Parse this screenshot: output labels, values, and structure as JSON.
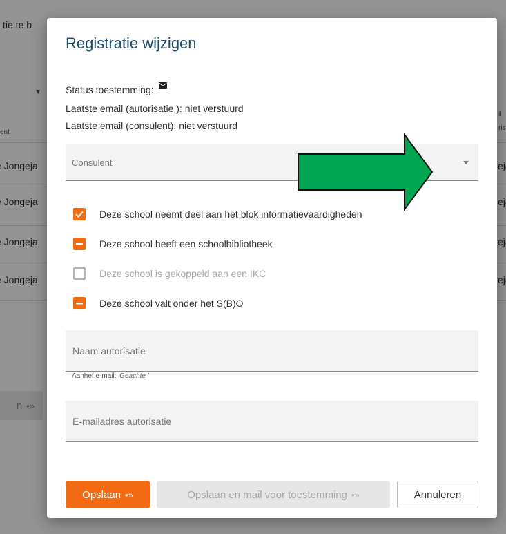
{
  "background": {
    "heading_fragment": "tie te b",
    "column_fragment": "ent",
    "rows": [
      "e Jongeja",
      "e Jongeja",
      "e Jongeja",
      "e Jongeja"
    ],
    "right_header_top": "il",
    "right_header_bottom": "ris",
    "right_rows": [
      "eja",
      "eja",
      "eja",
      "eja"
    ],
    "button_fragment": "n",
    "button_arrow": "•»"
  },
  "modal": {
    "title": "Registratie wijzigen",
    "status_label": "Status toestemming:",
    "last_email_auth": "Laatste email (autorisatie ): niet verstuurd",
    "last_email_consultant": "Laatste email (consulent): niet verstuurd",
    "consultant_select": {
      "label": "Consulent",
      "icon": "chevron-down-icon"
    },
    "checkboxes": [
      {
        "label": "Deze school neemt deel aan het blok informatievaardigheden",
        "state": "checked"
      },
      {
        "label": "Deze school heeft een schoolbibliotheek",
        "state": "indeterminate"
      },
      {
        "label": "Deze school is gekoppeld aan een IKC",
        "state": "unchecked"
      },
      {
        "label": "Deze school valt onder het S(B)O",
        "state": "indeterminate"
      }
    ],
    "name_field": {
      "placeholder": "Naam autorisatie",
      "value": ""
    },
    "salutation_label": "Aanhef e-mail:",
    "salutation_value": "'Geachte '",
    "email_field": {
      "placeholder": "E-mailadres autorisatie",
      "value": ""
    },
    "buttons": {
      "save": "Opslaan",
      "save_and_mail": "Opslaan en mail voor toestemming",
      "cancel": "Annuleren",
      "arrow_glyph": "•»"
    }
  },
  "colors": {
    "accent": "#f26a12",
    "title": "#1b4e6b",
    "annotation_arrow": "#00a651"
  }
}
